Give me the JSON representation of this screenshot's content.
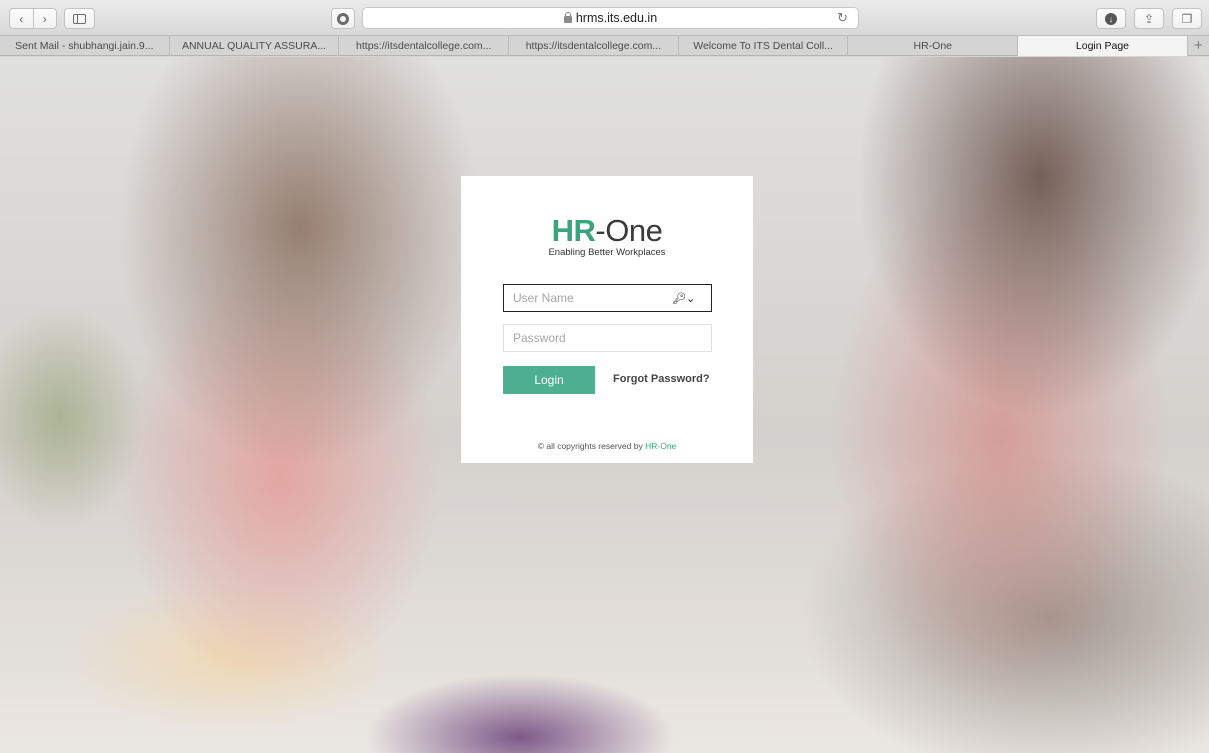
{
  "browser": {
    "url": "hrms.its.edu.in",
    "back_glyph": "‹",
    "forward_glyph": "›",
    "reload_glyph": "↻",
    "share_glyph": "⇪",
    "tabs_glyph": "❐",
    "download_glyph": "↓",
    "new_tab_glyph": "+"
  },
  "tabs": [
    {
      "label": "Sent Mail - shubhangi.jain.9..."
    },
    {
      "label": "ANNUAL QUALITY ASSURA..."
    },
    {
      "label": "https://itsdentalcollege.com..."
    },
    {
      "label": "https://itsdentalcollege.com..."
    },
    {
      "label": "Welcome To ITS Dental Coll..."
    },
    {
      "label": "HR-One"
    },
    {
      "label": "Login Page"
    }
  ],
  "login": {
    "logo_hr": "HR",
    "logo_one": "-One",
    "tagline": "Enabling Better Workplaces",
    "username_placeholder": "User Name",
    "password_placeholder": "Password",
    "key_glyph": "🔑︎⌄",
    "login_label": "Login",
    "forgot_label": "Forgot Password?",
    "copyright_prefix": "© all copyrights reserved by ",
    "copyright_brand": "HR-One"
  },
  "colors": {
    "accent": "#4caf8f",
    "brand_green": "#3aa57c"
  }
}
